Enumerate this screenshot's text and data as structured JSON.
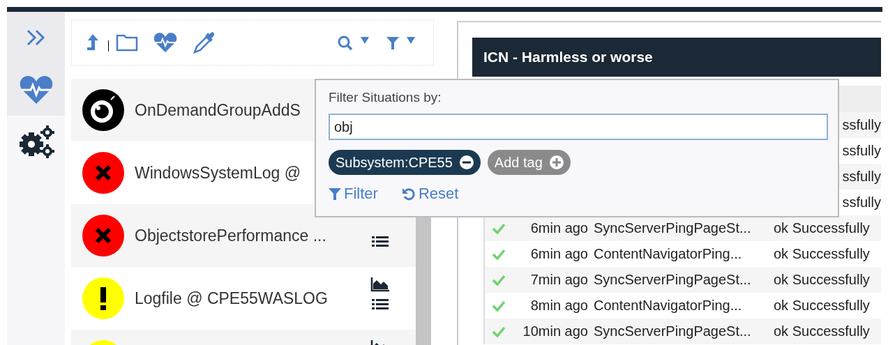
{
  "sidebar": {
    "items": [
      {
        "selected": true
      },
      {
        "selected": false
      }
    ]
  },
  "situations": [
    {
      "kind": "unknown",
      "name": "OnDemandGroupAddS"
    },
    {
      "kind": "critical",
      "name": "WindowsSystemLog @"
    },
    {
      "kind": "critical",
      "name": "ObjectstorePerformance ...",
      "list": true
    },
    {
      "kind": "warning",
      "name": "Logfile @ CPE55WASLOG",
      "chart": true,
      "list": true
    },
    {
      "kind": "warning",
      "chart": true
    }
  ],
  "panel": {
    "title": "ICN - Harmless or worse",
    "rows": [
      {
        "status": "ssfully"
      },
      {
        "status": "ssfully"
      },
      {
        "status": "ssfully"
      },
      {
        "status": "ssfully"
      },
      {
        "check": true,
        "time": "6min ago",
        "name": "SyncServerPingPageSt...",
        "status": "ok Successfully"
      },
      {
        "check": true,
        "time": "6min ago",
        "name": "ContentNavigatorPing...",
        "status": "ok Successfully"
      },
      {
        "check": true,
        "time": "7min ago",
        "name": "SyncServerPingPageSt...",
        "status": "ok Successfully"
      },
      {
        "check": true,
        "time": "8min ago",
        "name": "ContentNavigatorPing...",
        "status": "ok Successfully"
      },
      {
        "check": true,
        "time": "10min ago",
        "name": "SyncServerPingPageSt...",
        "status": "ok Successfully"
      }
    ]
  },
  "filter_popup": {
    "label": "Filter Situations by:",
    "value": "obj",
    "tags": [
      {
        "kind": "tag",
        "label": "Subsystem:CPE55"
      },
      {
        "kind": "add",
        "label": "Add tag"
      }
    ],
    "actions": [
      {
        "kind": "filter",
        "label": "Filter"
      },
      {
        "kind": "reset",
        "label": "Reset"
      }
    ]
  }
}
